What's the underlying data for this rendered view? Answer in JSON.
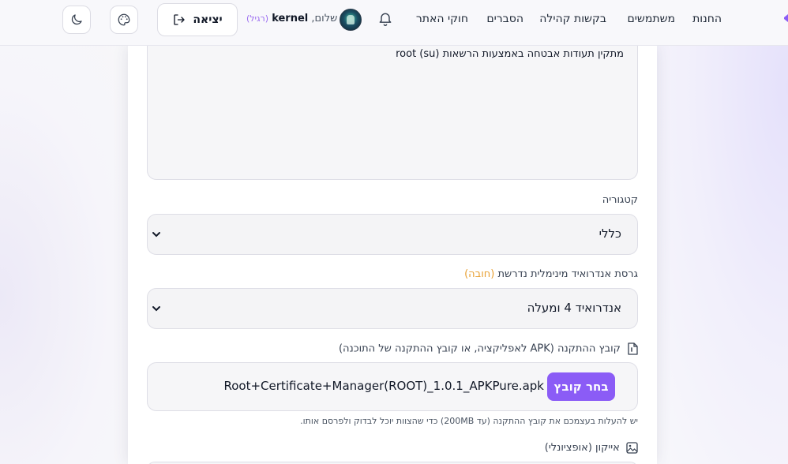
{
  "nav": {
    "items": [
      {
        "key": "shops",
        "label": "החנות"
      },
      {
        "key": "users",
        "label": "משתמשים"
      },
      {
        "key": "requests",
        "label": "בקשות קהילה"
      },
      {
        "key": "explanations",
        "label": "הסברים"
      },
      {
        "key": "rules",
        "label": "חוקי האתר"
      }
    ],
    "greeting": {
      "hello": "שלום,",
      "username": "kernel",
      "role": "(רגיל)"
    },
    "logout_label": "יציאה"
  },
  "form": {
    "description_value": "מתקין תעודות אבטחה באמצעות הרשאות root (su)",
    "category_label": "קטגוריה",
    "category_value": "כללי",
    "android_label": "גרסת אנדרואיד מינימלית נדרשת",
    "android_required": "(חובה)",
    "android_value": "אנדרואיד 4 ומעלה",
    "apk_label": "קובץ ההתקנה (APK לאפליקציה, או קובץ ההתקנה של התוכנה)",
    "choose_file_label": "בחר קובץ",
    "file_name": "Root+Certificate+Manager(ROOT)_1.0.1_APKPure.apk",
    "apk_help": "יש להעלות בעצמכם את קובץ ההתקנה (עד 200MB) כדי שהצוות יוכל לבדוק ולפרסם אותו.",
    "icon_label": "אייקון (אופציונלי)"
  },
  "colors": {
    "accent": "#8b5cf6",
    "required": "#e8a032",
    "role": "#9b6cf0"
  }
}
